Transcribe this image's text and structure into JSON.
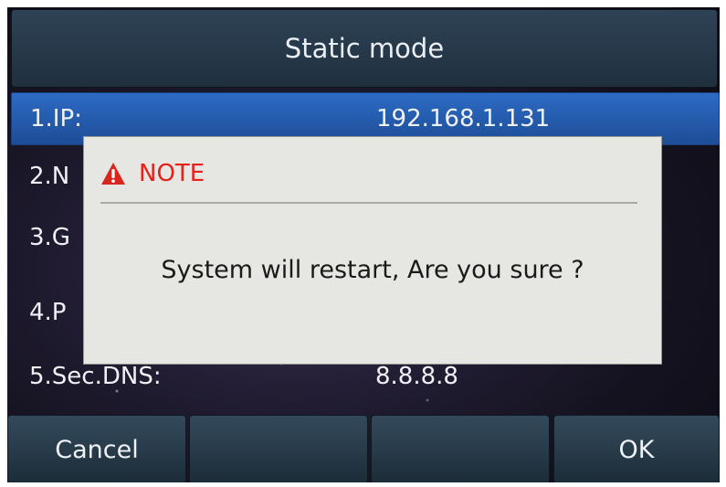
{
  "title": "Static mode",
  "rows": [
    {
      "label": "1.IP:",
      "value": "192.168.1.131"
    },
    {
      "label": "2.N",
      "value": ""
    },
    {
      "label": "3.G",
      "value": ""
    },
    {
      "label": "4.P",
      "value": ""
    },
    {
      "label": "5.Sec.DNS:",
      "value": "8.8.8.8"
    }
  ],
  "dialog": {
    "icon": "warning-icon",
    "title": "NOTE",
    "message": "System will restart, Are you sure ?"
  },
  "softkeys": [
    "Cancel",
    "",
    "",
    "OK"
  ],
  "colors": {
    "note": "#e8201a",
    "selected_row": "#2d6bc4",
    "dialog_bg": "#e6e7e3"
  }
}
